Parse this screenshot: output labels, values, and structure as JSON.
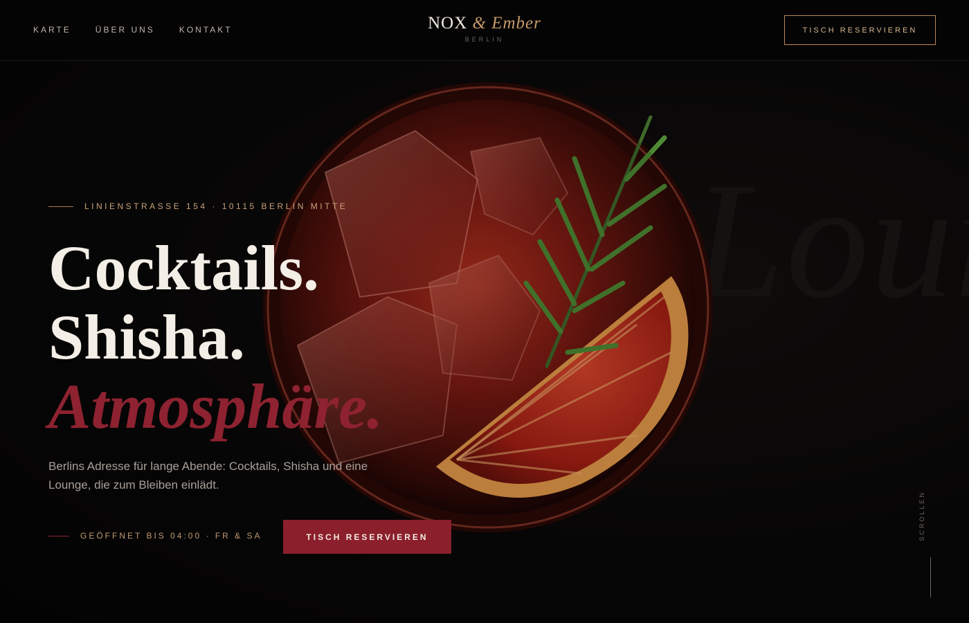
{
  "header": {
    "nav": [
      {
        "label": "KARTE"
      },
      {
        "label": "ÜBER UNS"
      },
      {
        "label": "KONTAKT"
      }
    ],
    "brand": {
      "name_a": "NOX",
      "amp": "&",
      "name_b": "Ember",
      "sub": "BERLIN"
    },
    "cta": "TISCH RESERVIEREN"
  },
  "hero": {
    "bg_word": "Lounge",
    "address": "LINIENSTRASSE 154 · 10115 BERLIN MITTE",
    "headline": [
      "Cocktails.",
      "Shisha.",
      "Atmosphäre."
    ],
    "lead": "Berlins Adresse für lange Abende: Cocktails, Shisha und eine Lounge, die zum Bleiben einlädt.",
    "hours": "GEÖFFNET BIS 04:00 · FR & SA",
    "cta": "TISCH RESERVIEREN",
    "scroll": "SCROLLEN"
  },
  "colors": {
    "accent": "#8b1f2b",
    "gold": "#b88a5e",
    "background": "#060505"
  }
}
